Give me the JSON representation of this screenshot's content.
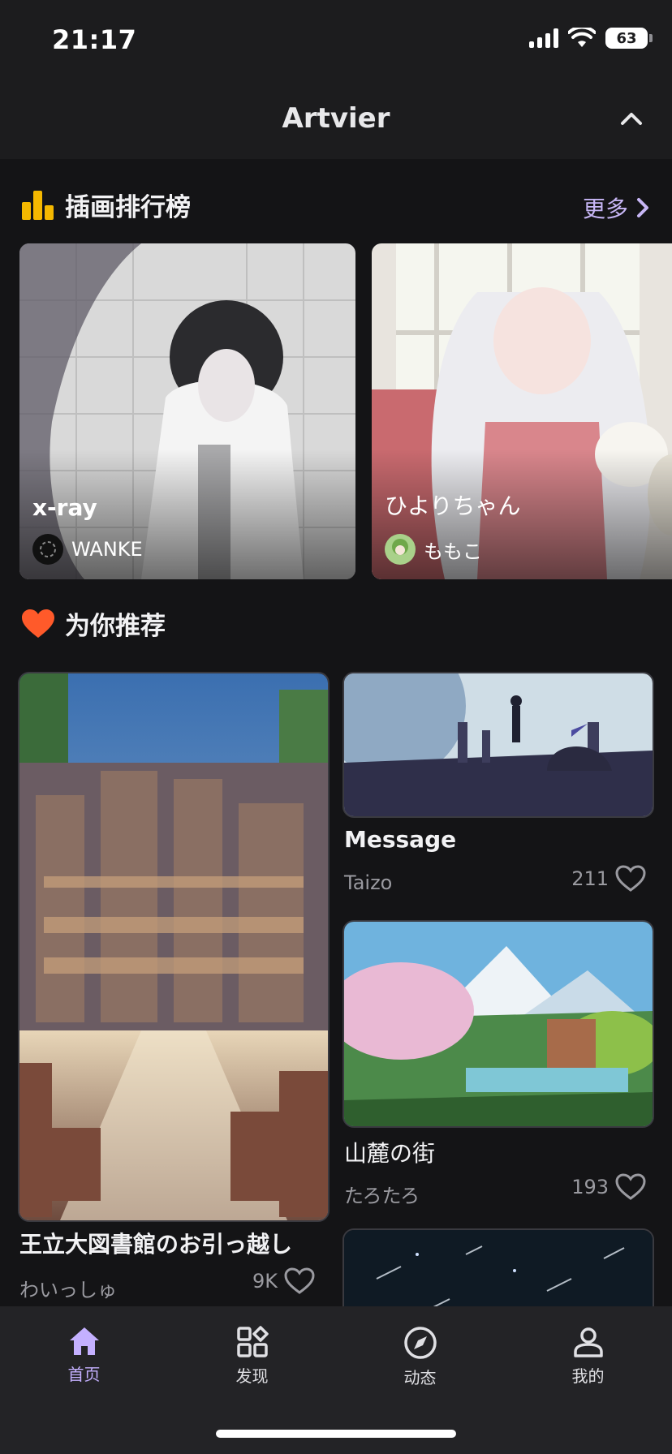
{
  "status_bar": {
    "time": "21:17",
    "battery": "63"
  },
  "header": {
    "title": "Artvier"
  },
  "ranking": {
    "title": "插画排行榜",
    "more_label": "更多",
    "cards": [
      {
        "title": "x-ray",
        "author": "WANKE"
      },
      {
        "title": "ひよりちゃん",
        "author": "ももこ"
      }
    ]
  },
  "recommend": {
    "title": "为你推荐",
    "items": [
      {
        "title": "王立大図書館のお引っ越し",
        "author": "わいっしゅ",
        "likes": "9K"
      },
      {
        "title": "Message",
        "author": "Taizo",
        "likes": "211"
      },
      {
        "title": "山麓の街",
        "author": "たろたろ",
        "likes": "193"
      }
    ]
  },
  "tabs": [
    {
      "label": "首页",
      "icon": "home-icon",
      "active": true
    },
    {
      "label": "发现",
      "icon": "grid-icon",
      "active": false
    },
    {
      "label": "动态",
      "icon": "compass-icon",
      "active": false
    },
    {
      "label": "我的",
      "icon": "profile-icon",
      "active": false
    }
  ],
  "colors": {
    "background": "#141416",
    "accent": "#c4b0ff",
    "rank_icon": "#f5b800",
    "heart_icon": "#ff5a2a"
  }
}
